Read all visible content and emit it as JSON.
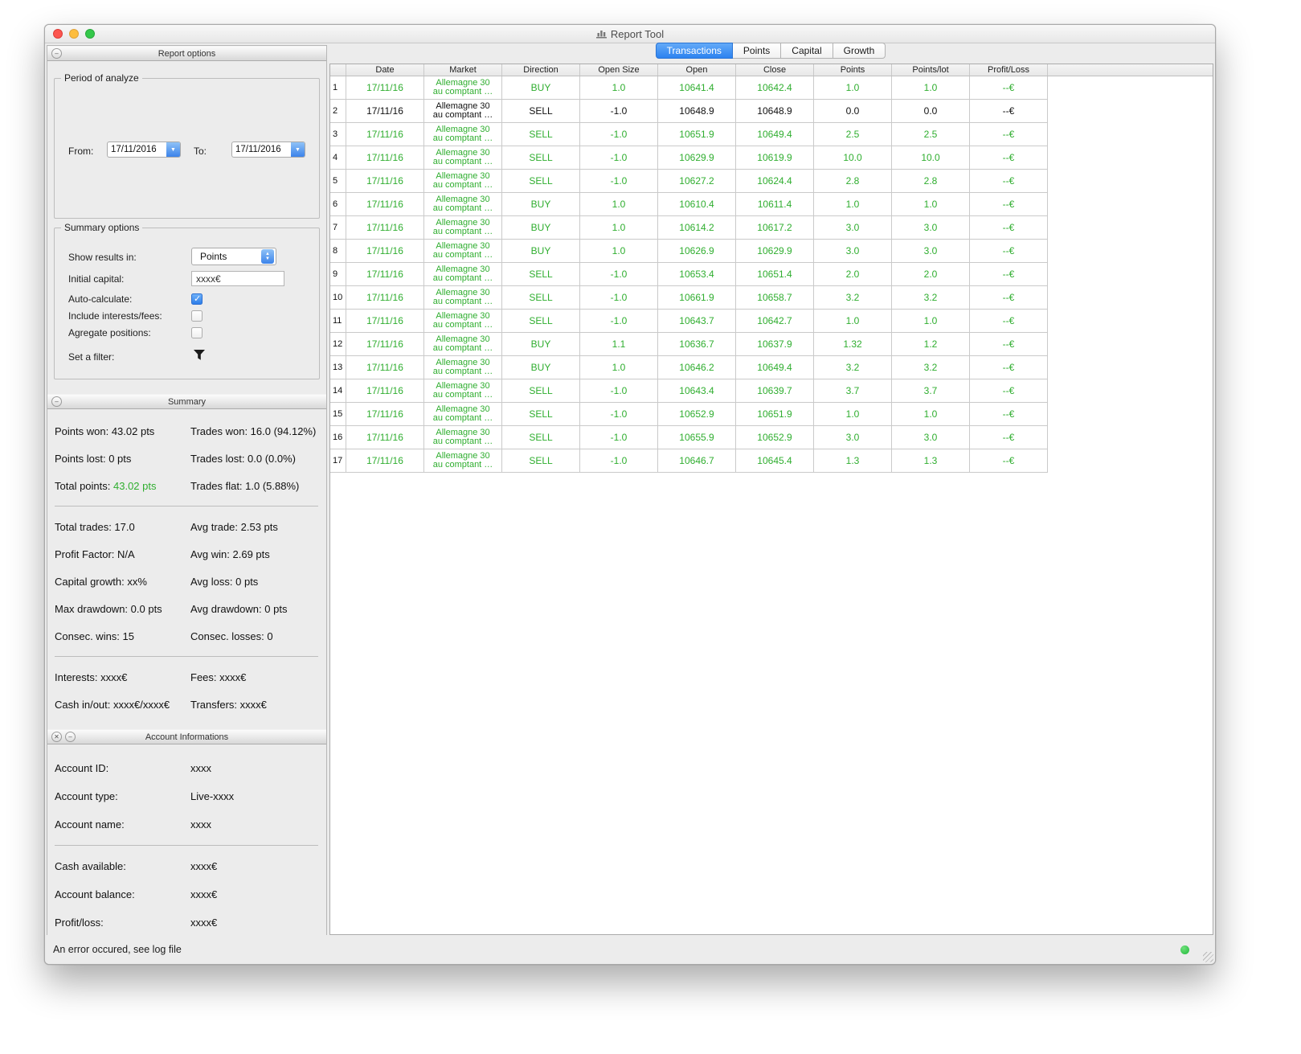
{
  "window": {
    "title": "Report Tool",
    "status": {
      "error_text": "An error occured, see log file"
    }
  },
  "colors": {
    "green": "#2fae2f",
    "accent_blue": "#3e8cef"
  },
  "icons": {
    "combo_arrow": "▼",
    "stepper_up": "▲",
    "stepper_down": "▼",
    "close": "✕",
    "collapse": "–"
  },
  "sidebar": {
    "report_options": {
      "title": "Report options",
      "period": {
        "group_label": "Period of analyze",
        "from_label": "From:",
        "from_value": "17/11/2016",
        "to_label": "To:",
        "to_value": "17/11/2016"
      },
      "options": {
        "group_label": "Summary options",
        "show_results_label": "Show results in:",
        "show_results_value": "Points",
        "initial_capital_label": "Initial capital:",
        "initial_capital_value": "xxxx€",
        "auto_calculate_label": "Auto-calculate:",
        "auto_calculate_checked": true,
        "include_interests_label": "Include interests/fees:",
        "include_interests_checked": false,
        "agregate_label": "Agregate positions:",
        "agregate_checked": false,
        "filter_label": "Set a filter:"
      }
    },
    "summary": {
      "title": "Summary",
      "groups": [
        {
          "rows": [
            {
              "left": "Points won: 43.02 pts",
              "right": "Trades won: 16.0 (94.12%)"
            },
            {
              "left": "Points lost: 0 pts",
              "right": "Trades lost: 0.0 (0.0%)"
            },
            {
              "left_label": "Total points: ",
              "left_value": "43.02 pts",
              "right": "Trades flat: 1.0 (5.88%)"
            }
          ]
        },
        {
          "rows": [
            {
              "left": "Total trades: 17.0",
              "right": "Avg trade: 2.53 pts"
            },
            {
              "left": "Profit Factor: N/A",
              "right": "Avg win: 2.69 pts"
            },
            {
              "left": "Capital growth: xx%",
              "right": "Avg loss: 0 pts"
            },
            {
              "left": "Max drawdown: 0.0 pts",
              "right": "Avg drawdown: 0 pts"
            },
            {
              "left": "Consec. wins: 15",
              "right": "Consec. losses: 0"
            }
          ]
        },
        {
          "rows": [
            {
              "left": "Interests: xxxx€",
              "right": "Fees: xxxx€"
            },
            {
              "left": "Cash in/out: xxxx€/xxxx€",
              "right": "Transfers: xxxx€"
            }
          ]
        }
      ]
    },
    "account": {
      "title": "Account Informations",
      "groups": [
        {
          "rows": [
            {
              "label": "Account ID:",
              "value": "xxxx"
            },
            {
              "label": "Account type:",
              "value": "Live-xxxx"
            },
            {
              "label": "Account name:",
              "value": "xxxx"
            }
          ]
        },
        {
          "rows": [
            {
              "label": "Cash available:",
              "value": "xxxx€"
            },
            {
              "label": "Account balance:",
              "value": "xxxx€"
            },
            {
              "label": "Profit/loss:",
              "value": "xxxx€"
            }
          ]
        }
      ]
    }
  },
  "main": {
    "tabs": [
      {
        "label": "Transactions",
        "active": true
      },
      {
        "label": "Points",
        "active": false
      },
      {
        "label": "Capital",
        "active": false
      },
      {
        "label": "Growth",
        "active": false
      }
    ],
    "table": {
      "columns": [
        "",
        "Date",
        "Market",
        "Direction",
        "Open Size",
        "Open",
        "Close",
        "Points",
        "Points/lot",
        "Profit/Loss"
      ],
      "rows": [
        {
          "num": "1",
          "date": "17/11/16",
          "market": "Allemagne 30\nau comptant …",
          "direction": "BUY",
          "open_size": "1.0",
          "open": "10641.4",
          "close": "10642.4",
          "points": "1.0",
          "points_lot": "1.0",
          "profit": "--€",
          "color": "green"
        },
        {
          "num": "2",
          "date": "17/11/16",
          "market": "Allemagne 30\nau comptant …",
          "direction": "SELL",
          "open_size": "-1.0",
          "open": "10648.9",
          "close": "10648.9",
          "points": "0.0",
          "points_lot": "0.0",
          "profit": "--€",
          "color": "black"
        },
        {
          "num": "3",
          "date": "17/11/16",
          "market": "Allemagne 30\nau comptant …",
          "direction": "SELL",
          "open_size": "-1.0",
          "open": "10651.9",
          "close": "10649.4",
          "points": "2.5",
          "points_lot": "2.5",
          "profit": "--€",
          "color": "green"
        },
        {
          "num": "4",
          "date": "17/11/16",
          "market": "Allemagne 30\nau comptant …",
          "direction": "SELL",
          "open_size": "-1.0",
          "open": "10629.9",
          "close": "10619.9",
          "points": "10.0",
          "points_lot": "10.0",
          "profit": "--€",
          "color": "green"
        },
        {
          "num": "5",
          "date": "17/11/16",
          "market": "Allemagne 30\nau comptant …",
          "direction": "SELL",
          "open_size": "-1.0",
          "open": "10627.2",
          "close": "10624.4",
          "points": "2.8",
          "points_lot": "2.8",
          "profit": "--€",
          "color": "green"
        },
        {
          "num": "6",
          "date": "17/11/16",
          "market": "Allemagne 30\nau comptant …",
          "direction": "BUY",
          "open_size": "1.0",
          "open": "10610.4",
          "close": "10611.4",
          "points": "1.0",
          "points_lot": "1.0",
          "profit": "--€",
          "color": "green"
        },
        {
          "num": "7",
          "date": "17/11/16",
          "market": "Allemagne 30\nau comptant …",
          "direction": "BUY",
          "open_size": "1.0",
          "open": "10614.2",
          "close": "10617.2",
          "points": "3.0",
          "points_lot": "3.0",
          "profit": "--€",
          "color": "green"
        },
        {
          "num": "8",
          "date": "17/11/16",
          "market": "Allemagne 30\nau comptant …",
          "direction": "BUY",
          "open_size": "1.0",
          "open": "10626.9",
          "close": "10629.9",
          "points": "3.0",
          "points_lot": "3.0",
          "profit": "--€",
          "color": "green"
        },
        {
          "num": "9",
          "date": "17/11/16",
          "market": "Allemagne 30\nau comptant …",
          "direction": "SELL",
          "open_size": "-1.0",
          "open": "10653.4",
          "close": "10651.4",
          "points": "2.0",
          "points_lot": "2.0",
          "profit": "--€",
          "color": "green"
        },
        {
          "num": "10",
          "date": "17/11/16",
          "market": "Allemagne 30\nau comptant …",
          "direction": "SELL",
          "open_size": "-1.0",
          "open": "10661.9",
          "close": "10658.7",
          "points": "3.2",
          "points_lot": "3.2",
          "profit": "--€",
          "color": "green"
        },
        {
          "num": "11",
          "date": "17/11/16",
          "market": "Allemagne 30\nau comptant …",
          "direction": "SELL",
          "open_size": "-1.0",
          "open": "10643.7",
          "close": "10642.7",
          "points": "1.0",
          "points_lot": "1.0",
          "profit": "--€",
          "color": "green"
        },
        {
          "num": "12",
          "date": "17/11/16",
          "market": "Allemagne 30\nau comptant …",
          "direction": "BUY",
          "open_size": "1.1",
          "open": "10636.7",
          "close": "10637.9",
          "points": "1.32",
          "points_lot": "1.2",
          "profit": "--€",
          "color": "green"
        },
        {
          "num": "13",
          "date": "17/11/16",
          "market": "Allemagne 30\nau comptant …",
          "direction": "BUY",
          "open_size": "1.0",
          "open": "10646.2",
          "close": "10649.4",
          "points": "3.2",
          "points_lot": "3.2",
          "profit": "--€",
          "color": "green"
        },
        {
          "num": "14",
          "date": "17/11/16",
          "market": "Allemagne 30\nau comptant …",
          "direction": "SELL",
          "open_size": "-1.0",
          "open": "10643.4",
          "close": "10639.7",
          "points": "3.7",
          "points_lot": "3.7",
          "profit": "--€",
          "color": "green"
        },
        {
          "num": "15",
          "date": "17/11/16",
          "market": "Allemagne 30\nau comptant …",
          "direction": "SELL",
          "open_size": "-1.0",
          "open": "10652.9",
          "close": "10651.9",
          "points": "1.0",
          "points_lot": "1.0",
          "profit": "--€",
          "color": "green"
        },
        {
          "num": "16",
          "date": "17/11/16",
          "market": "Allemagne 30\nau comptant …",
          "direction": "SELL",
          "open_size": "-1.0",
          "open": "10655.9",
          "close": "10652.9",
          "points": "3.0",
          "points_lot": "3.0",
          "profit": "--€",
          "color": "green"
        },
        {
          "num": "17",
          "date": "17/11/16",
          "market": "Allemagne 30\nau comptant …",
          "direction": "SELL",
          "open_size": "-1.0",
          "open": "10646.7",
          "close": "10645.4",
          "points": "1.3",
          "points_lot": "1.3",
          "profit": "--€",
          "color": "green"
        }
      ]
    }
  }
}
